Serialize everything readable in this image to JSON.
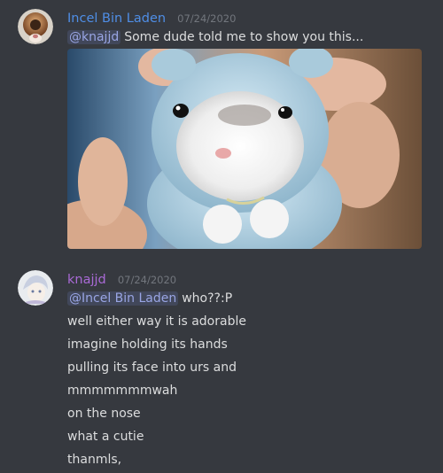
{
  "messages": [
    {
      "author": "Incel Bin Laden",
      "author_color": "#4f8ee6",
      "timestamp": "07/24/2020",
      "lines": [
        {
          "mention": "@knajjd",
          "text": "Some dude told me to show you this..."
        }
      ],
      "attachment": "hamster-in-blue-hood-image"
    },
    {
      "author": "knajjd",
      "author_color": "#a96ad6",
      "timestamp": "07/24/2020",
      "lines": [
        {
          "mention": "@Incel Bin Laden",
          "text": "who??:P"
        },
        {
          "text": "well either way it is adorable"
        },
        {
          "text": "imagine holding its hands"
        },
        {
          "text": "pulling its face into urs and"
        },
        {
          "text": "mmmmmmmwah"
        },
        {
          "text": "on the nose"
        },
        {
          "text": "what a cutie"
        },
        {
          "text": "thanmls,"
        }
      ]
    }
  ]
}
